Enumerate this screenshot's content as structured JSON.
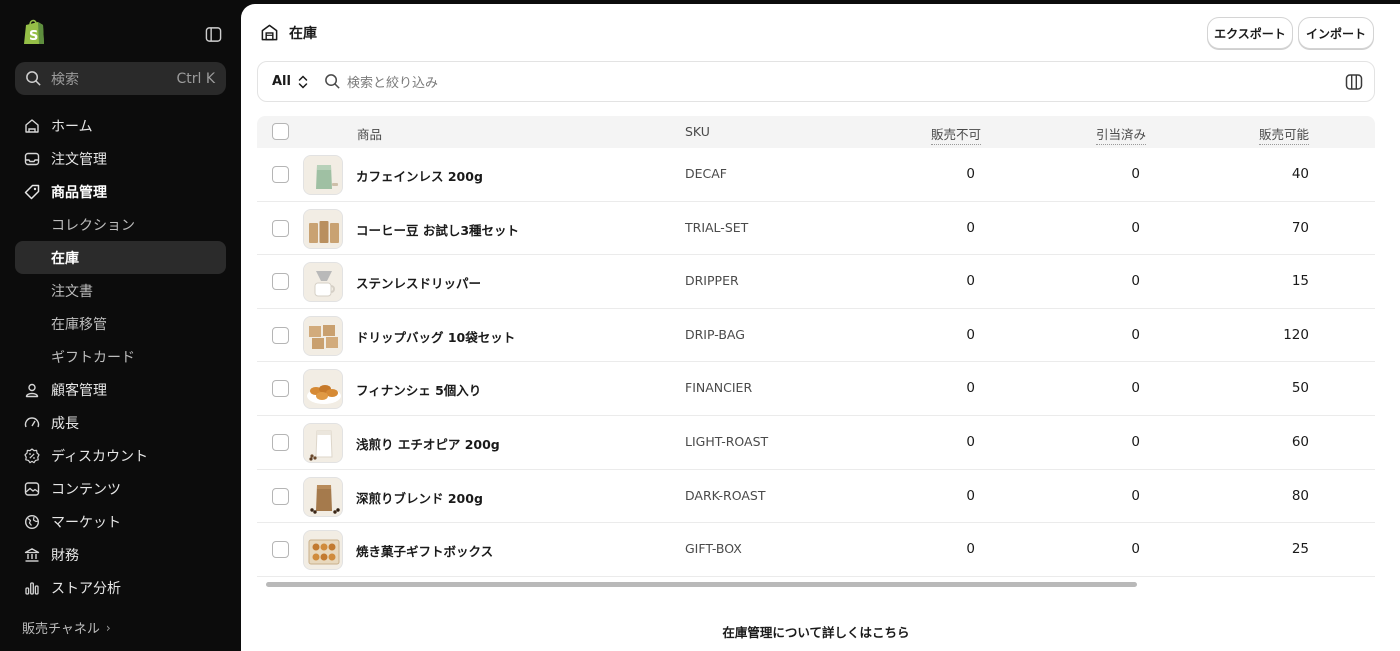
{
  "sidebar": {
    "search": {
      "placeholder": "検索",
      "shortcut": "Ctrl K"
    },
    "items": [
      {
        "label": "ホーム",
        "icon": "home-icon"
      },
      {
        "label": "注文管理",
        "icon": "inbox-icon"
      },
      {
        "label": "商品管理",
        "icon": "tag-icon"
      },
      {
        "label": "コレクション",
        "sub": true
      },
      {
        "label": "在庫",
        "sub": true,
        "active": true
      },
      {
        "label": "注文書",
        "sub": true
      },
      {
        "label": "在庫移管",
        "sub": true
      },
      {
        "label": "ギフトカード",
        "sub": true
      },
      {
        "label": "顧客管理",
        "icon": "person-icon"
      },
      {
        "label": "成長",
        "icon": "gauge-icon"
      },
      {
        "label": "ディスカウント",
        "icon": "discount-icon"
      },
      {
        "label": "コンテンツ",
        "icon": "image-icon"
      },
      {
        "label": "マーケット",
        "icon": "globe-icon"
      },
      {
        "label": "財務",
        "icon": "bank-icon"
      },
      {
        "label": "ストア分析",
        "icon": "chart-icon"
      }
    ],
    "sales_channels": "販売チャネル"
  },
  "header": {
    "title": "在庫",
    "export": "エクスポート",
    "import": "インポート"
  },
  "filter": {
    "view": "All",
    "placeholder": "検索と絞り込み"
  },
  "table": {
    "columns": {
      "product": "商品",
      "sku": "SKU",
      "unavailable": "販売不可",
      "committed": "引当済み",
      "available": "販売可能"
    },
    "rows": [
      {
        "name": "カフェインレス 200g",
        "sku": "DECAF",
        "unavailable": "0",
        "committed": "0",
        "available": "40",
        "thumb": "bag-green"
      },
      {
        "name": "コーヒー豆 お試し3種セット",
        "sku": "TRIAL-SET",
        "unavailable": "0",
        "committed": "0",
        "available": "70",
        "thumb": "three-bags"
      },
      {
        "name": "ステンレスドリッパー",
        "sku": "DRIPPER",
        "unavailable": "0",
        "committed": "0",
        "available": "15",
        "thumb": "dripper"
      },
      {
        "name": "ドリップバッグ 10袋セット",
        "sku": "DRIP-BAG",
        "unavailable": "0",
        "committed": "0",
        "available": "120",
        "thumb": "drip-bags"
      },
      {
        "name": "フィナンシェ 5個入り",
        "sku": "FINANCIER",
        "unavailable": "0",
        "committed": "0",
        "available": "50",
        "thumb": "financier"
      },
      {
        "name": "浅煎り エチオピア 200g",
        "sku": "LIGHT-ROAST",
        "unavailable": "0",
        "committed": "0",
        "available": "60",
        "thumb": "bag-white"
      },
      {
        "name": "深煎りブレンド 200g",
        "sku": "DARK-ROAST",
        "unavailable": "0",
        "committed": "0",
        "available": "80",
        "thumb": "bag-kraft"
      },
      {
        "name": "焼き菓子ギフトボックス",
        "sku": "GIFT-BOX",
        "unavailable": "0",
        "committed": "0",
        "available": "25",
        "thumb": "gift-box"
      }
    ]
  },
  "footer": {
    "learn_more": "在庫管理について詳しくはこちら"
  },
  "colors": {
    "sidebar_bg": "#0c0c0c",
    "active_item": "#2b2b2b",
    "brand_green": "#95bf47"
  }
}
